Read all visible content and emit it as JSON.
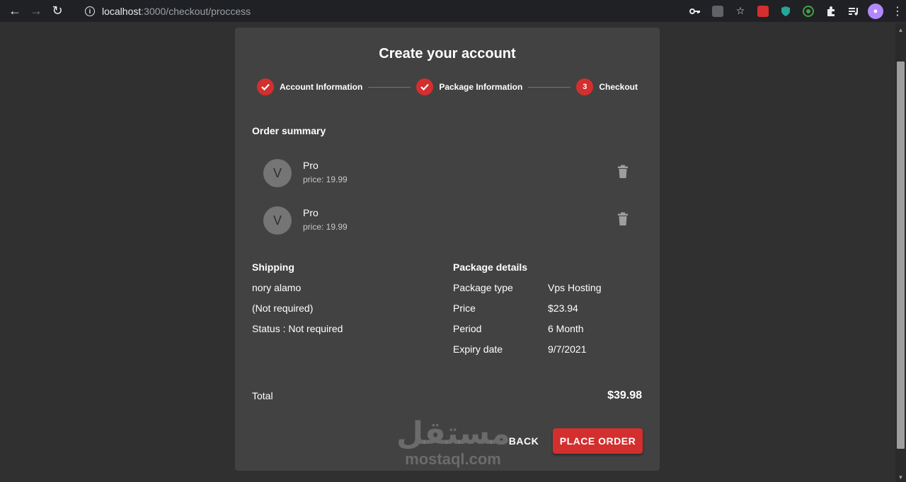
{
  "browser": {
    "url_host": "localhost",
    "url_path": ":3000/checkout/proccess"
  },
  "card": {
    "title": "Create your account",
    "steps": [
      {
        "label": "Account Information",
        "state": "completed"
      },
      {
        "label": "Package Information",
        "state": "completed"
      },
      {
        "label": "Checkout",
        "number": "3",
        "state": "active"
      }
    ]
  },
  "order": {
    "title": "Order summary",
    "items": [
      {
        "avatar": "V",
        "name": "Pro",
        "price": "price: 19.99"
      },
      {
        "avatar": "V",
        "name": "Pro",
        "price": "price: 19.99"
      }
    ]
  },
  "shipping": {
    "title": "Shipping",
    "name": "nory alamo",
    "note": "(Not required)",
    "status": "Status : Not required"
  },
  "package_details": {
    "title": "Package details",
    "rows": [
      {
        "label": "Package type",
        "value": "Vps Hosting"
      },
      {
        "label": "Price",
        "value": "$23.94"
      },
      {
        "label": "Period",
        "value": "6 Month"
      },
      {
        "label": "Expiry date",
        "value": "9/7/2021"
      }
    ]
  },
  "total": {
    "label": "Total",
    "value": "$39.98"
  },
  "actions": {
    "back": "BACK",
    "place_order": "PLACE ORDER"
  },
  "watermark": {
    "arabic": "مستقل",
    "latin": "mostaql.com"
  },
  "colors": {
    "accent": "#d32f2f",
    "card": "#424242",
    "background": "#303030"
  }
}
